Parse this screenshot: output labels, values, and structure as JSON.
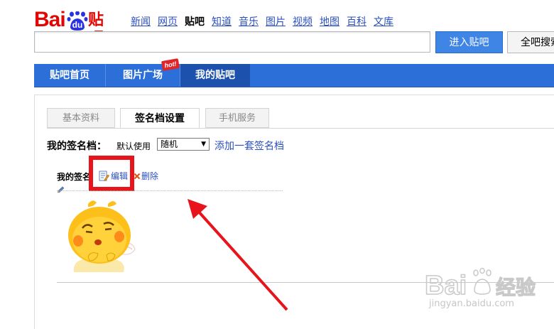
{
  "logo": {
    "bai": "Bai",
    "du": "du",
    "tieba": "贴吧"
  },
  "top_nav": {
    "items": [
      {
        "label": "新闻",
        "active": false
      },
      {
        "label": "网页",
        "active": false
      },
      {
        "label": "贴吧",
        "active": true
      },
      {
        "label": "知道",
        "active": false
      },
      {
        "label": "音乐",
        "active": false
      },
      {
        "label": "图片",
        "active": false
      },
      {
        "label": "视频",
        "active": false
      },
      {
        "label": "地图",
        "active": false
      },
      {
        "label": "百科",
        "active": false
      },
      {
        "label": "文库",
        "active": false
      }
    ]
  },
  "search": {
    "value": "",
    "enter_button": "进入贴吧",
    "all_button": "全吧搜索"
  },
  "main_nav": {
    "home": "贴吧首页",
    "plaza": "图片广场",
    "mine": "我的贴吧",
    "hot_badge": "hot!"
  },
  "tabs": {
    "basic": "基本资料",
    "signature": "签名档设置",
    "mobile": "手机服务"
  },
  "signature_settings": {
    "label": "我的签名档：",
    "default_use": "默认使用",
    "select_value": "随机",
    "add_link": "添加一套签名档"
  },
  "signature_item": {
    "name": "我的签名",
    "edit": "编辑",
    "delete": "删除"
  },
  "watermark": {
    "url": "jingyan.baidu.com"
  },
  "colors": {
    "brand_red": "#e10601",
    "nav_blue": "#2d6fd8",
    "link_blue": "#2a4fbf",
    "highlight_red": "#e8141b"
  }
}
